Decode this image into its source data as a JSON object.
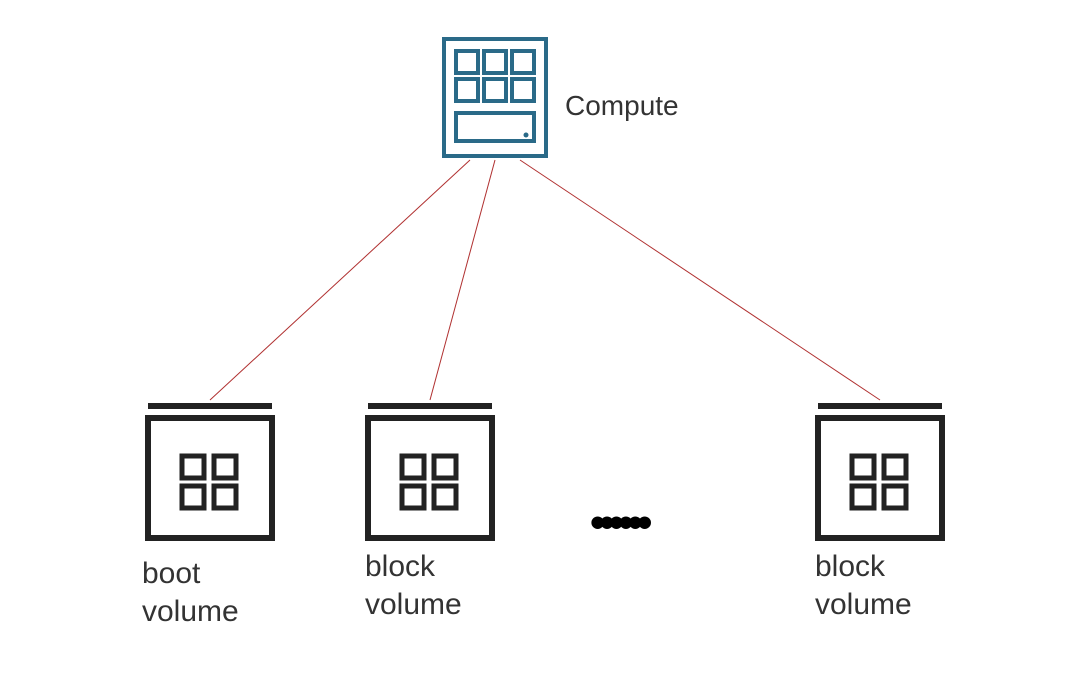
{
  "diagram": {
    "top_node": {
      "label": "Compute",
      "icon": "compute-server-icon",
      "accent_color": "#2a6a88"
    },
    "child_nodes": [
      {
        "label_line1": "boot",
        "label_line2": "volume",
        "icon": "storage-volume-icon"
      },
      {
        "label_line1": "block",
        "label_line2": "volume",
        "icon": "storage-volume-icon"
      },
      {
        "label_line1": "block",
        "label_line2": "volume",
        "icon": "storage-volume-icon"
      }
    ],
    "ellipsis": "••••••",
    "connector_color": "#b03030",
    "node_stroke": "#222222"
  }
}
